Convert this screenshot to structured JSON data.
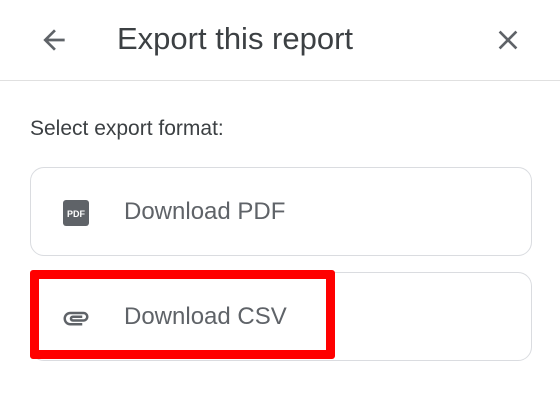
{
  "dialog": {
    "title": "Export this report",
    "back_icon": "arrow-left-icon",
    "close_icon": "close-icon"
  },
  "section": {
    "label": "Select export format:"
  },
  "options": [
    {
      "label": "Download PDF",
      "icon": "pdf-file-icon"
    },
    {
      "label": "Download CSV",
      "icon": "paperclip-icon"
    }
  ],
  "colors": {
    "text": "#3c4043",
    "option_text": "#5f6368",
    "icon": "#5f6368",
    "border": "#dadce0",
    "highlight": "#ff0000"
  }
}
